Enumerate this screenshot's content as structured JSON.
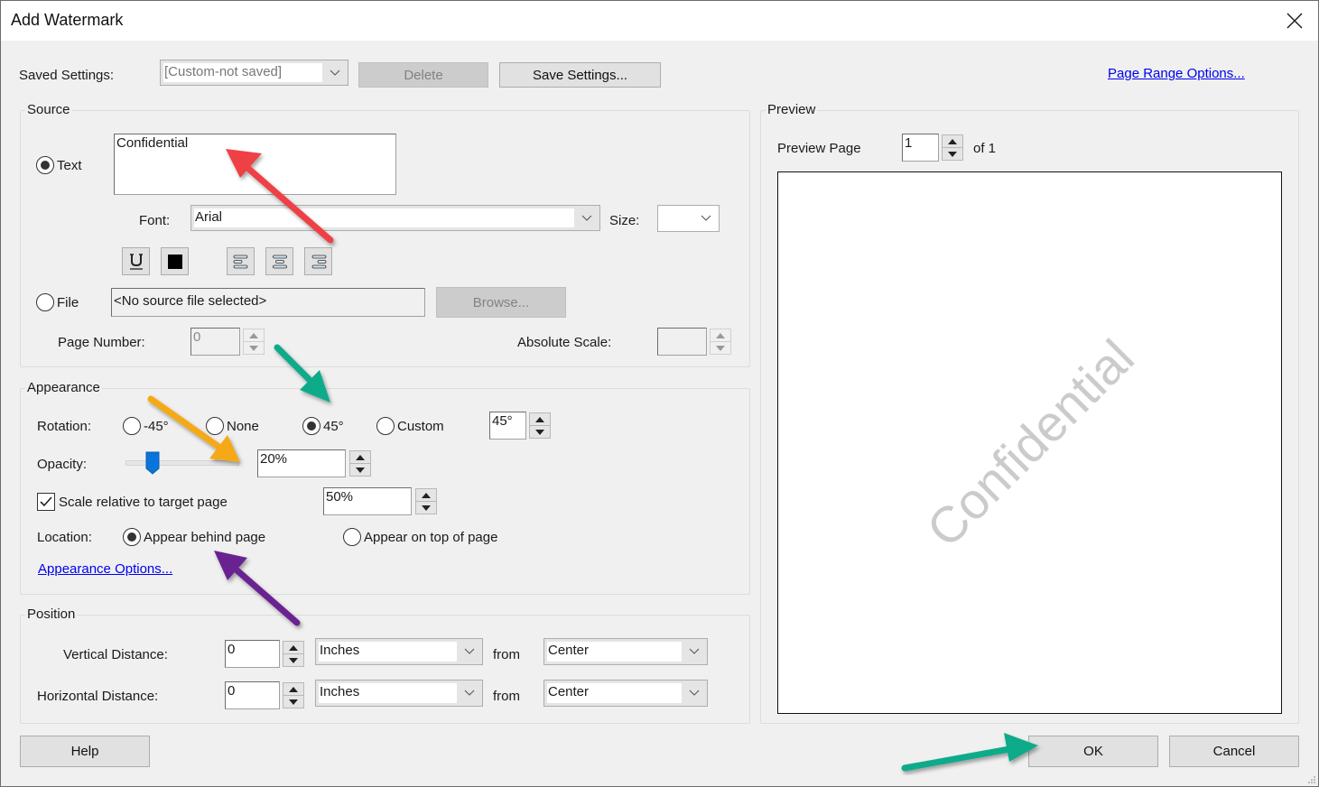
{
  "window": {
    "title": "Add Watermark",
    "close_icon": "close-icon"
  },
  "saved_settings": {
    "label": "Saved Settings:",
    "value": "[Custom-not saved]",
    "delete_label": "Delete",
    "save_label": "Save Settings..."
  },
  "page_range_link": "Page Range Options...",
  "source": {
    "title": "Source",
    "text_radio": {
      "label": "Text",
      "selected": true
    },
    "text_value": "Confidential",
    "font_label": "Font:",
    "font_value": "Arial",
    "size_label": "Size:",
    "size_value": "",
    "format_buttons": [
      {
        "name": "underline",
        "icon": "underline-icon"
      },
      {
        "name": "text-color",
        "icon": "color-swatch-icon",
        "color": "#000000"
      },
      {
        "name": "align-left",
        "icon": "align-left-icon"
      },
      {
        "name": "align-center",
        "icon": "align-center-icon"
      },
      {
        "name": "align-right",
        "icon": "align-right-icon"
      }
    ],
    "file_radio": {
      "label": "File",
      "selected": false
    },
    "file_value": "<No source file selected>",
    "browse_label": "Browse...",
    "page_number_label": "Page Number:",
    "page_number_value": "0",
    "absolute_scale_label": "Absolute Scale:",
    "absolute_scale_value": ""
  },
  "appearance": {
    "title": "Appearance",
    "rotation_label": "Rotation:",
    "rotation_options": [
      {
        "label": "-45°",
        "selected": false
      },
      {
        "label": "None",
        "selected": false
      },
      {
        "label": "45°",
        "selected": true
      },
      {
        "label": "Custom",
        "selected": false
      }
    ],
    "rotation_custom_value": "45°",
    "opacity_label": "Opacity:",
    "opacity_value": "20%",
    "opacity_percent": 20,
    "scale_checkbox_label": "Scale relative to target page",
    "scale_checked": true,
    "scale_value": "50%",
    "location_label": "Location:",
    "location_options": [
      {
        "label": "Appear behind page",
        "selected": true
      },
      {
        "label": "Appear on top of page",
        "selected": false
      }
    ],
    "options_link": "Appearance Options..."
  },
  "position": {
    "title": "Position",
    "vertical_label": "Vertical Distance:",
    "vertical_value": "0",
    "vertical_unit": "Inches",
    "vertical_from_label": "from",
    "vertical_from": "Center",
    "horizontal_label": "Horizontal Distance:",
    "horizontal_value": "0",
    "horizontal_unit": "Inches",
    "horizontal_from_label": "from",
    "horizontal_from": "Center"
  },
  "preview": {
    "title": "Preview",
    "page_label": "Preview Page",
    "page_value": "1",
    "page_of": "of 1",
    "watermark_text": "Confidential",
    "watermark_rotation_deg": 45
  },
  "footer": {
    "help_label": "Help",
    "ok_label": "OK",
    "cancel_label": "Cancel"
  },
  "annotations": {
    "colors": {
      "red": "#ef3f45",
      "teal": "#0aab8a",
      "orange": "#f5a915",
      "purple": "#6a2291"
    }
  }
}
